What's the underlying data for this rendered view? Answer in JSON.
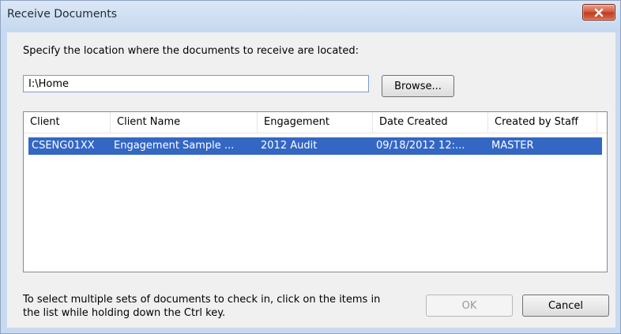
{
  "window": {
    "title": "Receive Documents"
  },
  "instruction": "Specify the location where the documents to receive are located:",
  "location": {
    "value": "I:\\Home"
  },
  "buttons": {
    "browse": "Browse...",
    "ok": "OK",
    "cancel": "Cancel"
  },
  "table": {
    "columns": [
      "Client",
      "Client Name",
      "Engagement",
      "Date Created",
      "Created by Staff"
    ],
    "rows": [
      [
        "CSENG01XX",
        "Engagement Sample ...",
        "2012 Audit",
        "09/18/2012 12:...",
        "MASTER"
      ]
    ],
    "selected_row": 0
  },
  "footer": {
    "line1": "To select multiple sets of documents to check in, click on the items in",
    "line2": "the list while holding down the Ctrl key."
  },
  "colors": {
    "selection": "#3467c4",
    "titlebar": "#c9daf0",
    "close": "#d2563b"
  },
  "icons": {
    "close": "close-icon"
  }
}
